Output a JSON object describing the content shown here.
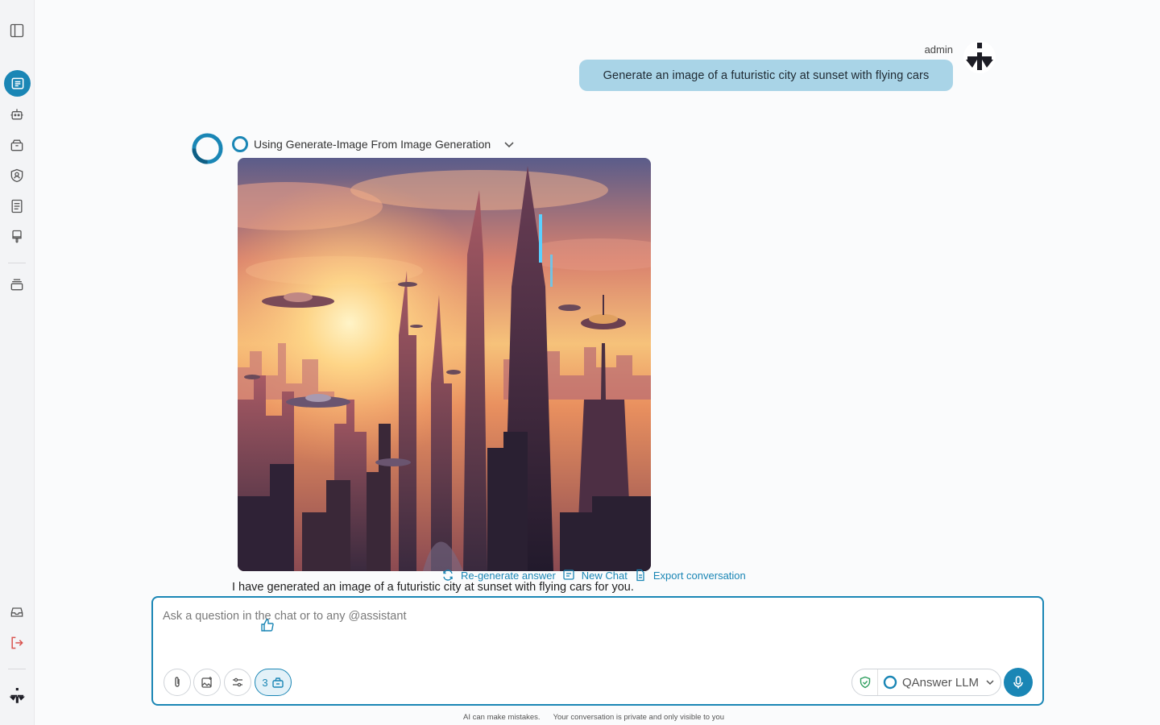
{
  "colors": {
    "accent": "#1a86b5",
    "user_bubble": "#a9d4e7",
    "shield": "#2e9e5e"
  },
  "sidebar": {
    "items": [
      {
        "name": "sidebar-toggle",
        "icon": "panel-left-icon"
      },
      {
        "name": "chat",
        "icon": "chat-icon",
        "active": true
      },
      {
        "name": "assistants",
        "icon": "robot-icon"
      },
      {
        "name": "packages",
        "icon": "package-icon"
      },
      {
        "name": "security",
        "icon": "shield-user-icon"
      },
      {
        "name": "documents",
        "icon": "document-icon"
      },
      {
        "name": "brush",
        "icon": "brush-icon"
      },
      {
        "name": "stack",
        "icon": "stack-icon"
      },
      {
        "name": "inbox",
        "icon": "inbox-icon"
      },
      {
        "name": "logout",
        "icon": "logout-icon"
      },
      {
        "name": "logo",
        "icon": "brand-logo-icon"
      }
    ]
  },
  "conversation": {
    "user": {
      "name": "admin",
      "message": "Generate an image of a futuristic city at sunset with flying cars"
    },
    "assistant": {
      "tool_label": "Using Generate-Image From Image Generation",
      "answer": "I have generated an image of a futuristic city at sunset with flying cars for you.",
      "actions": {
        "regenerate": "Re-generate answer",
        "new_chat": "New Chat",
        "export": "Export conversation"
      }
    }
  },
  "composer": {
    "placeholder": "Ask a question in the chat or to any @assistant",
    "tools_count": "3",
    "model": "QAnswer LLM"
  },
  "footer": {
    "disclaimer": "AI can make mistakes.",
    "privacy": "Your conversation is private and only visible to you"
  }
}
